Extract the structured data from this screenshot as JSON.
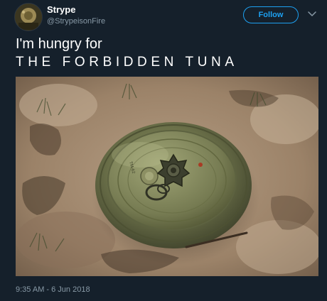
{
  "tweet": {
    "author": {
      "display_name": "Strype",
      "handle": "@StrypeisonFire",
      "avatar_icon": "avatar-image"
    },
    "follow_label": "Follow",
    "menu_icon": "chevron-down-icon",
    "text_line1": "I'm hungry for",
    "text_line2": "THE FORBIDDEN TUNA",
    "media": {
      "subject": "landmine-photo",
      "stamped_text": "TM-62"
    },
    "timestamp": "9:35 AM - 6 Jun 2018"
  },
  "colors": {
    "background": "#15202b",
    "accent": "#1da1f2",
    "secondary_text": "#8899a6",
    "primary_text": "#ffffff"
  }
}
